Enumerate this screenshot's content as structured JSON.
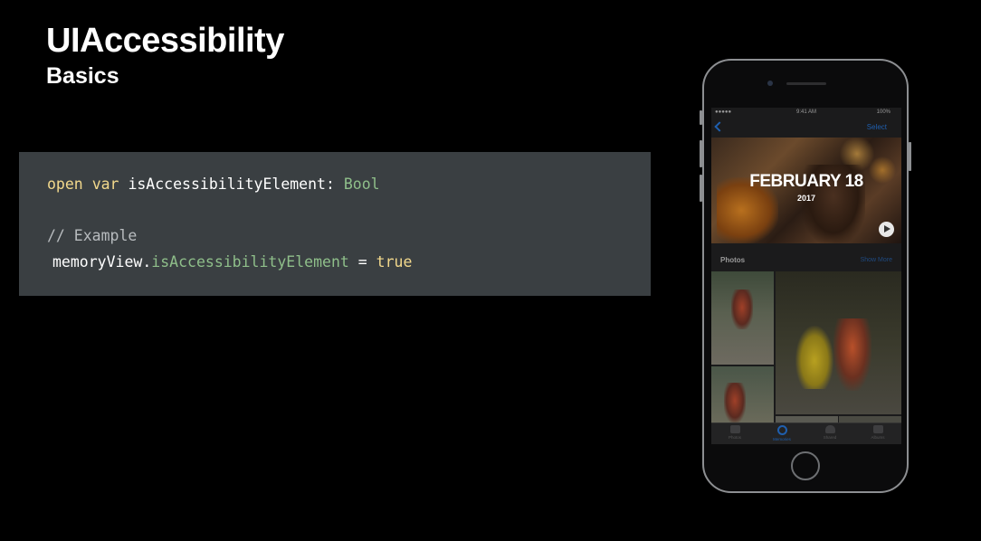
{
  "slide": {
    "title": "UIAccessibility",
    "subtitle": "Basics"
  },
  "code": {
    "line1": {
      "kw1": "open",
      "kw2": "var",
      "name": "isAccessibilityElement:",
      "type": "Bool"
    },
    "line2": {
      "comment": "// Example"
    },
    "line3": {
      "obj": "memoryView.",
      "prop": "isAccessibilityElement",
      "op": "=",
      "value": "true"
    }
  },
  "phone": {
    "status": {
      "time": "9:41 AM",
      "battery": "100%"
    },
    "nav": {
      "select_label": "Select"
    },
    "memory": {
      "title": "FEBRUARY 18",
      "year": "2017"
    },
    "photos": {
      "title": "Photos",
      "show_more": "Show More"
    },
    "tabs": [
      {
        "label": "Photos"
      },
      {
        "label": "Memories"
      },
      {
        "label": "Shared"
      },
      {
        "label": "Albums"
      }
    ]
  },
  "colors": {
    "keyword": "#f3d98c",
    "type": "#8fbf8a",
    "comment": "#b8bcbf",
    "code_bg": "#3a3f42",
    "ios_blue": "#1f5fae"
  }
}
